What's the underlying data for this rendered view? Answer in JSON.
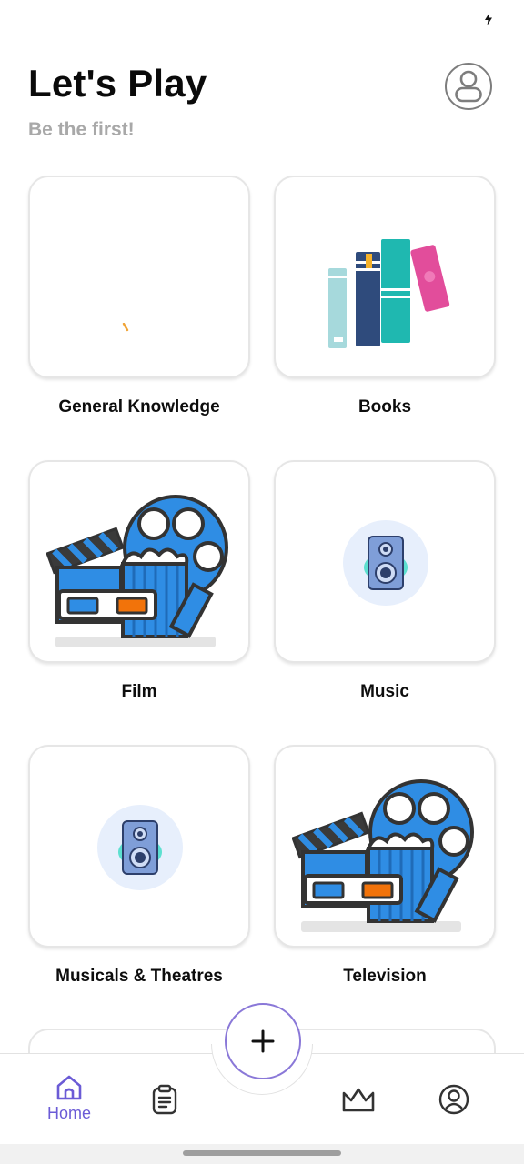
{
  "header": {
    "title": "Let's Play",
    "subtitle": "Be the first!"
  },
  "categories": [
    {
      "label": "General Knowledge",
      "icon": "loading-spinner-icon"
    },
    {
      "label": "Books",
      "icon": "books-icon"
    },
    {
      "label": "Film",
      "icon": "film-icon"
    },
    {
      "label": "Music",
      "icon": "speaker-icon"
    },
    {
      "label": "Musicals & Theatres",
      "icon": "speaker-icon"
    },
    {
      "label": "Television",
      "icon": "film-icon"
    }
  ],
  "bottom_nav": {
    "home_label": "Home",
    "items": [
      "home-icon",
      "clipboard-icon",
      "crown-icon",
      "user-icon"
    ],
    "fab_symbol": "+"
  },
  "colors": {
    "accent": "#6b5bd6",
    "film_blue": "#2f8de4",
    "speaker_bg": "#e7effc"
  }
}
